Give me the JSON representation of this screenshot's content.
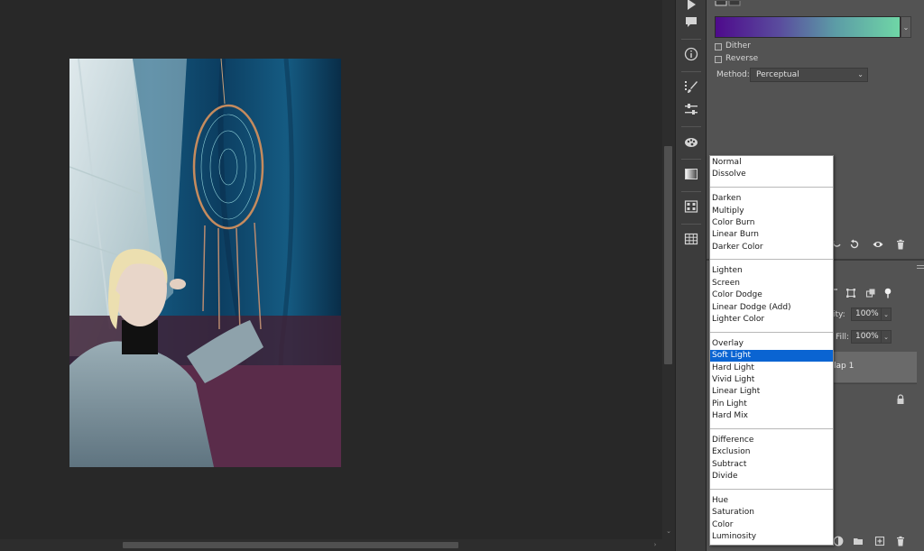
{
  "blend_menu": {
    "groups": [
      [
        "Normal",
        "Dissolve"
      ],
      [
        "Darken",
        "Multiply",
        "Color Burn",
        "Linear Burn",
        "Darker Color"
      ],
      [
        "Lighten",
        "Screen",
        "Color Dodge",
        "Linear Dodge (Add)",
        "Lighter Color"
      ],
      [
        "Overlay",
        "Soft Light",
        "Hard Light",
        "Vivid Light",
        "Linear Light",
        "Pin Light",
        "Hard Mix"
      ],
      [
        "Difference",
        "Exclusion",
        "Subtract",
        "Divide"
      ],
      [
        "Hue",
        "Saturation",
        "Color",
        "Luminosity"
      ]
    ],
    "selected": "Soft Light"
  },
  "gradient_panel": {
    "dither_label": "Dither",
    "reverse_label": "Reverse",
    "method_label": "Method:",
    "method_value": "Perceptual",
    "gradient_start_color": "#4e0a8c",
    "gradient_end_color": "#6fd6a6"
  },
  "layers_panel": {
    "opacity_label": "city:",
    "opacity_value": "100%",
    "fill_label": "Fill:",
    "fill_value": "100%",
    "layer_name": "lap 1"
  },
  "tools": [
    "play-icon",
    "comment-icon",
    "info-icon",
    "brush-presets-icon",
    "adjustments-icon",
    "palette-icon",
    "gradient-icon",
    "swatches-icon",
    "table-icon"
  ],
  "colors": {
    "selection": "#0a64d2",
    "panel": "#535353",
    "canvas": "#282828"
  }
}
